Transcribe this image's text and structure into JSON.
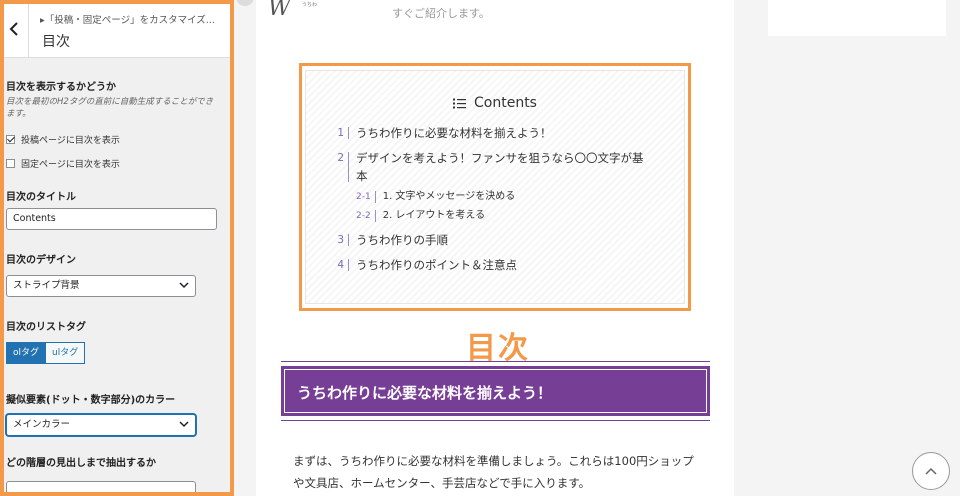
{
  "panel": {
    "breadcrumb": "▸「投稿・固定ページ」をカスタマイズ...",
    "title": "目次",
    "show_toc": {
      "label": "目次を表示するかどうか",
      "description": "目次を最初のH2タグの直前に自動生成することができます。",
      "checkbox_post": {
        "label": "投稿ページに目次を表示",
        "checked": true
      },
      "checkbox_page": {
        "label": "固定ページに目次を表示",
        "checked": false
      }
    },
    "toc_title": {
      "label": "目次のタイトル",
      "value": "Contents"
    },
    "toc_design": {
      "label": "目次のデザイン",
      "value": "ストライプ背景"
    },
    "toc_list_tag": {
      "label": "目次のリストタグ",
      "options": [
        "olタグ",
        "ulタグ"
      ],
      "selected": "olタグ"
    },
    "pseudo_color": {
      "label": "擬似要素(ドット・数字部分)のカラー",
      "value": "メインカラー"
    },
    "depth": {
      "label": "どの階層の見出しまで抽出するか",
      "value": ""
    }
  },
  "preview": {
    "logo": "W",
    "logo_sub": "うちわ",
    "intro_text": "すぐご紹介します。",
    "side_text": "",
    "toc": {
      "heading": "Contents",
      "items": [
        {
          "num": "1",
          "text": "うちわ作りに必要な材料を揃えよう！"
        },
        {
          "num": "2",
          "text": "デザインを考えよう！ファンサを狙うなら〇〇文字が基",
          "text2": "本"
        },
        {
          "num": "2-1",
          "text": "1. 文字やメッセージを決める"
        },
        {
          "num": "2-2",
          "text": "2. レイアウトを考える"
        },
        {
          "num": "3",
          "text": "うちわ作りの手順"
        },
        {
          "num": "4",
          "text": "うちわ作りのポイント＆注意点"
        }
      ]
    },
    "annotation": "目次",
    "h2": "うちわ作りに必要な材料を揃えよう！",
    "body": "まずは、うちわ作りに必要な材料を準備しましょう。これらは100円ショップや文具店、ホームセンター、手芸店などで手に入ります。"
  },
  "colors": {
    "accent": "#f29a4a",
    "heading_bg": "#773e95",
    "wp_blue": "#2271b1"
  }
}
